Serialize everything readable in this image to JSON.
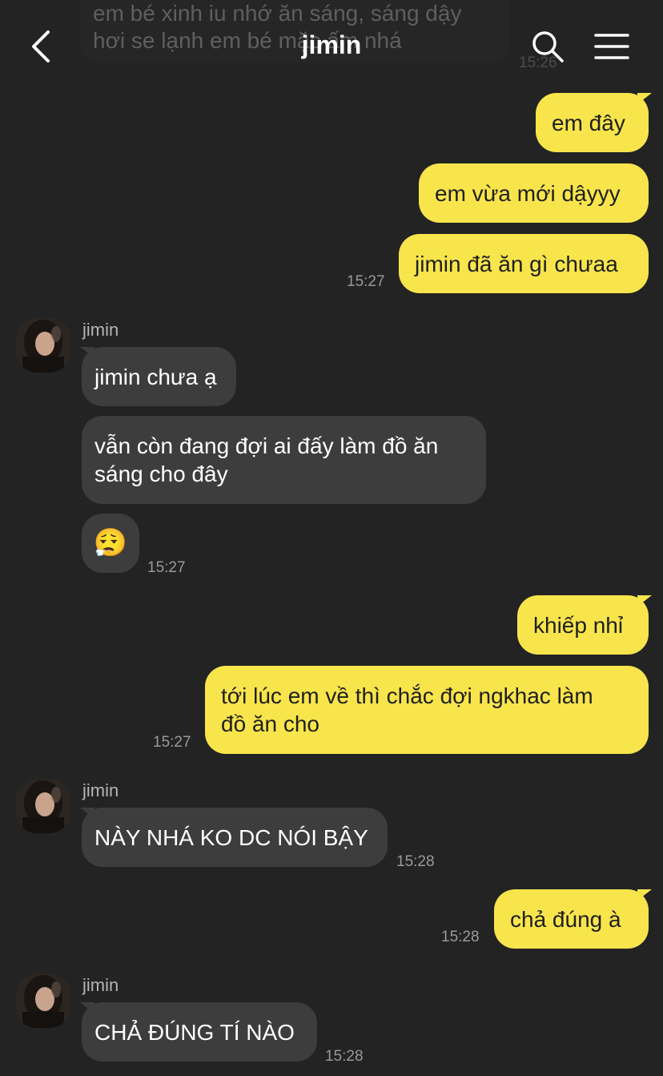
{
  "header": {
    "title": "jimin",
    "back_icon": "chevron-left-icon",
    "search_icon": "search-icon",
    "menu_icon": "hamburger-menu-icon"
  },
  "previous": {
    "text": "em bé xinh iu nhớ ăn sáng, sáng dậy\nhơi se lạnh em bé mặc ấm nhá",
    "time": "15:26"
  },
  "contact_name": "jimin",
  "messages": [
    {
      "text": "em đây"
    },
    {
      "text": "em vừa mới dậyyy"
    },
    {
      "text": "jimin đã ăn gì chưaa",
      "time": "15:27"
    },
    {
      "sender": "jimin",
      "text": "jimin chưa ạ"
    },
    {
      "text": "vẫn còn đang đợi ai đấy làm đồ ăn\nsáng cho đây"
    },
    {
      "emoji": "😮‍💨",
      "time": "15:27"
    },
    {
      "text": "khiếp nhỉ"
    },
    {
      "text": "tới lúc em về thì chắc đợi ngkhac làm\nđồ ăn cho",
      "time": "15:27"
    },
    {
      "sender": "jimin",
      "text": "NÀY NHÁ KO DC NÓI BẬY",
      "time": "15:28"
    },
    {
      "text": "chả đúng à",
      "time": "15:28"
    },
    {
      "sender": "jimin",
      "text": "CHẢ ĐÚNG TÍ NÀO",
      "time": "15:28"
    }
  ],
  "colors": {
    "background": "#232323",
    "outgoing_bubble": "#f8e54c",
    "incoming_bubble": "#3d3d3d"
  }
}
